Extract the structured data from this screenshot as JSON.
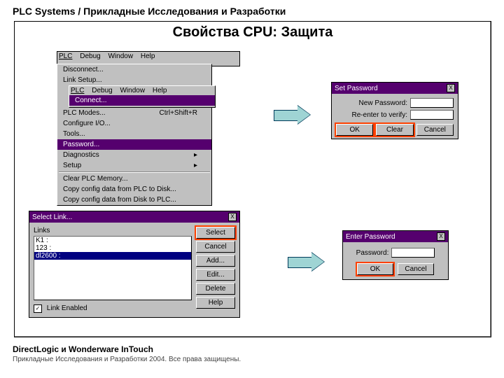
{
  "header": "PLC Systems / Прикладные Исследования и Разработки",
  "title": "Свойства CPU: Защита",
  "footer1": "DirectLogic и Wonderware InTouch",
  "footer2": "Прикладные Исследования и Разработки 2004. Все права защищены.",
  "menuA": {
    "bar": {
      "m1": "PLC",
      "m2": "Debug",
      "m3": "Window",
      "m4": "Help"
    },
    "i1": "Disconnect...",
    "i2": "Link Setup...",
    "subbar": {
      "m1": "PLC",
      "m2": "Debug",
      "m3": "Window",
      "m4": "Help"
    },
    "i3": "Connect...",
    "i4": "PLC Modes...",
    "i4s": "Ctrl+Shift+R",
    "i5": "Configure I/O...",
    "i6": "Tools...",
    "i7": "Password...",
    "i8": "Diagnostics",
    "i9": "Setup",
    "i10": "Clear PLC Memory...",
    "i11": "Copy config data from PLC to Disk...",
    "i12": "Copy config data from Disk to PLC..."
  },
  "setPwd": {
    "title": "Set Password",
    "l1": "New Password:",
    "l2": "Re-enter to verify:",
    "ok": "OK",
    "clear": "Clear",
    "cancel": "Cancel"
  },
  "selLink": {
    "title": "Select Link...",
    "groupLabel": "Links",
    "row1": "K1 :",
    "row2": "123 :",
    "row3": "dl2600 :",
    "chkLabel": "Link Enabled",
    "btn": {
      "select": "Select",
      "cancel": "Cancel",
      "add": "Add...",
      "edit": "Edit...",
      "del": "Delete",
      "help": "Help"
    }
  },
  "entPwd": {
    "title": "Enter Password",
    "l1": "Password:",
    "ok": "OK",
    "cancel": "Cancel"
  },
  "closeX": "X"
}
